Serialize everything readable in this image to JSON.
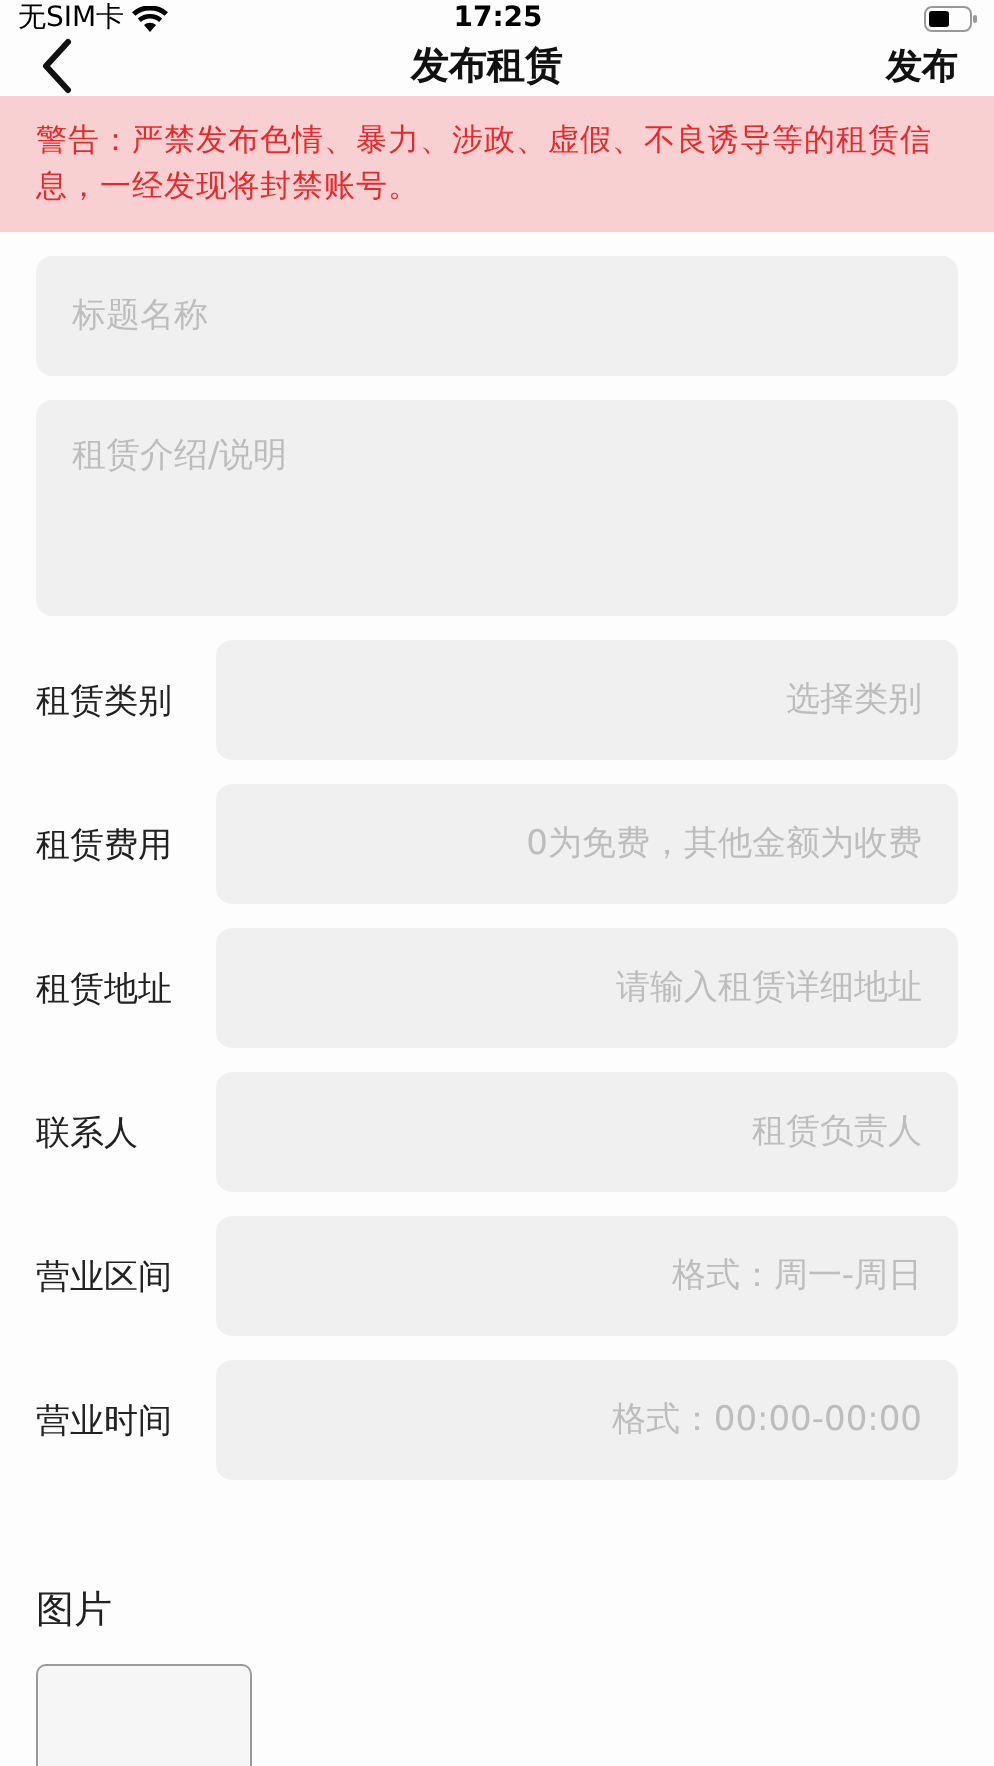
{
  "status_bar": {
    "carrier": "无SIM卡",
    "time": "17:25"
  },
  "nav": {
    "title": "发布租赁",
    "action": "发布"
  },
  "warning": "警告：严禁发布色情、暴力、涉政、虚假、不良诱导等的租赁信息，一经发现将封禁账号。",
  "title_field": {
    "placeholder": "标题名称"
  },
  "description_field": {
    "placeholder": "租赁介绍/说明"
  },
  "rows": [
    {
      "label": "租赁类别",
      "placeholder": "选择类别"
    },
    {
      "label": "租赁费用",
      "placeholder": "0为免费，其他金额为收费"
    },
    {
      "label": "租赁地址",
      "placeholder": "请输入租赁详细地址"
    },
    {
      "label": "联系人",
      "placeholder": "租赁负责人"
    },
    {
      "label": "营业区间",
      "placeholder": "格式：周一-周日"
    },
    {
      "label": "营业时间",
      "placeholder": "格式：00:00-00:00"
    }
  ],
  "images": {
    "label": "图片"
  }
}
